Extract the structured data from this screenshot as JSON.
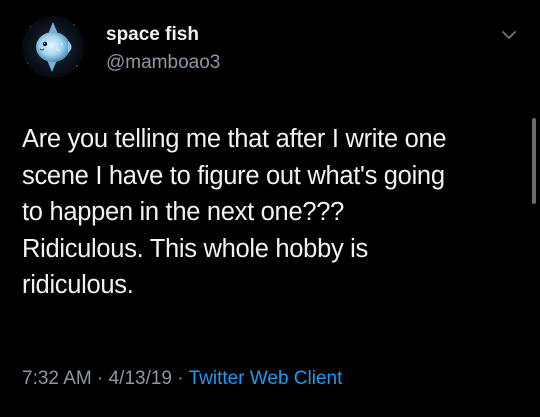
{
  "user": {
    "display_name": "space fish",
    "handle": "@mamboao3",
    "avatar_icon": "sunfish-avatar-icon"
  },
  "tweet": {
    "text": "Are you telling me that after I write one\nscene I have to figure out what's going\nto happen in the next one???\nRidiculous. This whole hobby is\nridiculous."
  },
  "meta": {
    "time": "7:32 AM",
    "separator": " · ",
    "date": "4/13/19",
    "client": "Twitter Web Client"
  },
  "menu": {
    "icon": "chevron-down-icon"
  },
  "colors": {
    "background": "#000000",
    "text": "#f2f2f2",
    "secondary": "#8b98a5",
    "link": "#1d9bf0"
  }
}
